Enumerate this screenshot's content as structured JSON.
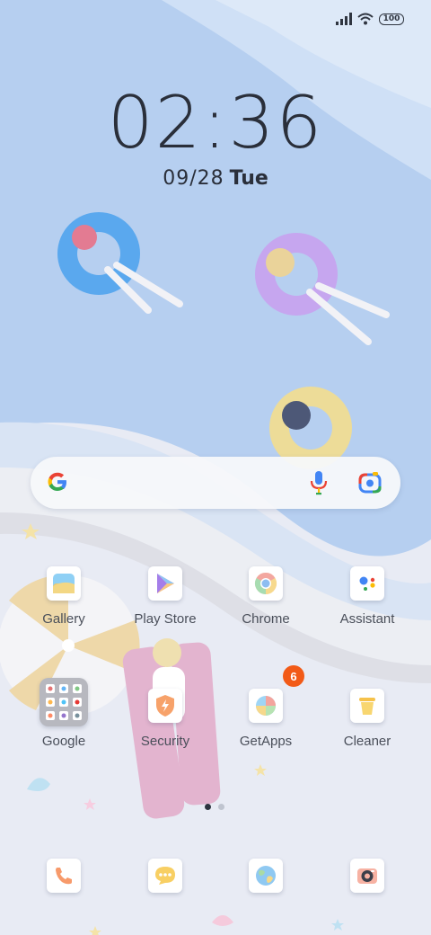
{
  "status_bar": {
    "battery": "100",
    "icons": [
      "signal-icon",
      "wifi-icon",
      "battery-icon"
    ]
  },
  "clock": {
    "time": "02:36"
  },
  "date": {
    "date": "09/28",
    "weekday": "Tue"
  },
  "search_bar": {
    "icons": [
      "google-logo-icon",
      "microphone-icon",
      "lens-camera-icon"
    ]
  },
  "apps": [
    {
      "label": "Gallery",
      "icon": "gallery-icon"
    },
    {
      "label": "Play Store",
      "icon": "play-store-icon"
    },
    {
      "label": "Chrome",
      "icon": "chrome-icon"
    },
    {
      "label": "Assistant",
      "icon": "assistant-icon"
    },
    {
      "label": "Google",
      "icon": "google-folder-icon"
    },
    {
      "label": "Security",
      "icon": "security-icon"
    },
    {
      "label": "GetApps",
      "icon": "getapps-icon",
      "badge": "6"
    },
    {
      "label": "Cleaner",
      "icon": "cleaner-icon"
    }
  ],
  "page_indicator": {
    "pages": 2,
    "current": 1
  },
  "dock": [
    {
      "icon": "phone-icon"
    },
    {
      "icon": "messages-icon"
    },
    {
      "icon": "browser-icon"
    },
    {
      "icon": "camera-icon"
    }
  ],
  "colors": {
    "badge": "#f25a17",
    "sea": "#b9d3f0",
    "sand": "#e7eaf3"
  }
}
